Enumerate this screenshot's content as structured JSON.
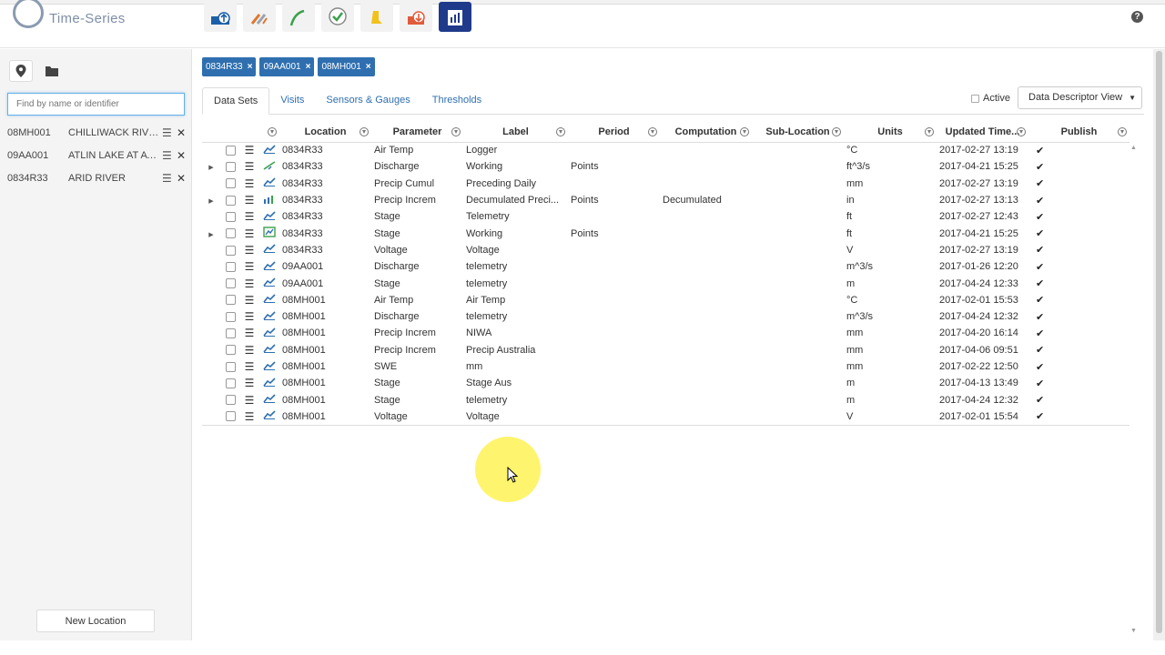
{
  "app": {
    "logo_text": "Time-Series"
  },
  "toolbar": {
    "buttons": [
      {
        "icon": "upload-icon"
      },
      {
        "icon": "tools-icon"
      },
      {
        "icon": "curve-icon"
      },
      {
        "icon": "approval-icon"
      },
      {
        "icon": "alert-icon"
      },
      {
        "icon": "download-icon"
      },
      {
        "icon": "report-icon"
      }
    ]
  },
  "sidebar": {
    "search_placeholder": "Find by name or identifier",
    "locations": [
      {
        "id": "08MH001",
        "name": "CHILLIWACK RIVE..."
      },
      {
        "id": "09AA001",
        "name": "ATLIN LAKE AT AT..."
      },
      {
        "id": "0834R33",
        "name": "ARID RIVER"
      }
    ],
    "new_location_label": "New Location"
  },
  "chips": [
    {
      "label": "0834R33"
    },
    {
      "label": "09AA001"
    },
    {
      "label": "08MH001"
    }
  ],
  "tabs": [
    "Data Sets",
    "Visits",
    "Sensors & Gauges",
    "Thresholds"
  ],
  "active_option_label": "Active",
  "view_select_value": "Data Descriptor View",
  "table": {
    "columns": [
      "Location",
      "Parameter",
      "Label",
      "Period",
      "Computation",
      "Sub-Location",
      "Units",
      "Updated Time...",
      "Publish"
    ],
    "rows": [
      {
        "location": "0834R33",
        "parameter": "Air Temp",
        "label": "Logger",
        "period": "",
        "computation": "",
        "sublocation": "",
        "units": "°C",
        "updated": "2017-02-27 13:19",
        "publish": "✔"
      },
      {
        "location": "0834R33",
        "parameter": "Discharge",
        "label": "Working",
        "period": "Points",
        "computation": "",
        "sublocation": "",
        "units": "ft^3/s",
        "updated": "2017-04-21 15:25",
        "publish": "✔"
      },
      {
        "location": "0834R33",
        "parameter": "Precip Cumul",
        "label": "Preceding Daily",
        "period": "",
        "computation": "",
        "sublocation": "",
        "units": "mm",
        "updated": "2017-02-27 13:19",
        "publish": "✔"
      },
      {
        "location": "0834R33",
        "parameter": "Precip Increm",
        "label": "Decumulated Preci...",
        "period": "Points",
        "computation": "Decumulated",
        "sublocation": "",
        "units": "in",
        "updated": "2017-02-27 13:13",
        "publish": "✔"
      },
      {
        "location": "0834R33",
        "parameter": "Stage",
        "label": "Telemetry",
        "period": "",
        "computation": "",
        "sublocation": "",
        "units": "ft",
        "updated": "2017-02-27 12:43",
        "publish": "✔"
      },
      {
        "location": "0834R33",
        "parameter": "Stage",
        "label": "Working",
        "period": "Points",
        "computation": "",
        "sublocation": "",
        "units": "ft",
        "updated": "2017-04-21 15:25",
        "publish": "✔"
      },
      {
        "location": "0834R33",
        "parameter": "Voltage",
        "label": "Voltage",
        "period": "",
        "computation": "",
        "sublocation": "",
        "units": "V",
        "updated": "2017-02-27 13:19",
        "publish": "✔"
      },
      {
        "location": "09AA001",
        "parameter": "Discharge",
        "label": "telemetry",
        "period": "",
        "computation": "",
        "sublocation": "",
        "units": "m^3/s",
        "updated": "2017-01-26 12:20",
        "publish": "✔"
      },
      {
        "location": "09AA001",
        "parameter": "Stage",
        "label": "telemetry",
        "period": "",
        "computation": "",
        "sublocation": "",
        "units": "m",
        "updated": "2017-04-24 12:33",
        "publish": "✔"
      },
      {
        "location": "08MH001",
        "parameter": "Air Temp",
        "label": "Air Temp",
        "period": "",
        "computation": "",
        "sublocation": "",
        "units": "°C",
        "updated": "2017-02-01 15:53",
        "publish": "✔"
      },
      {
        "location": "08MH001",
        "parameter": "Discharge",
        "label": "telemetry",
        "period": "",
        "computation": "",
        "sublocation": "",
        "units": "m^3/s",
        "updated": "2017-04-24 12:32",
        "publish": "✔"
      },
      {
        "location": "08MH001",
        "parameter": "Precip Increm",
        "label": "NIWA",
        "period": "",
        "computation": "",
        "sublocation": "",
        "units": "mm",
        "updated": "2017-04-20 16:14",
        "publish": "✔"
      },
      {
        "location": "08MH001",
        "parameter": "Precip Increm",
        "label": "Precip Australia",
        "period": "",
        "computation": "",
        "sublocation": "",
        "units": "mm",
        "updated": "2017-04-06 09:51",
        "publish": "✔"
      },
      {
        "location": "08MH001",
        "parameter": "SWE",
        "label": "mm",
        "period": "",
        "computation": "",
        "sublocation": "",
        "units": "mm",
        "updated": "2017-02-22 12:50",
        "publish": "✔"
      },
      {
        "location": "08MH001",
        "parameter": "Stage",
        "label": "Stage Aus",
        "period": "",
        "computation": "",
        "sublocation": "",
        "units": "m",
        "updated": "2017-04-13 13:49",
        "publish": "✔"
      },
      {
        "location": "08MH001",
        "parameter": "Stage",
        "label": "telemetry",
        "period": "",
        "computation": "",
        "sublocation": "",
        "units": "m",
        "updated": "2017-04-24 12:32",
        "publish": "✔"
      },
      {
        "location": "08MH001",
        "parameter": "Voltage",
        "label": "Voltage",
        "period": "",
        "computation": "",
        "sublocation": "",
        "units": "V",
        "updated": "2017-02-01 15:54",
        "publish": "✔"
      }
    ]
  },
  "row_meta": [
    {
      "expandable": false,
      "type_icon": "line-chart-icon"
    },
    {
      "expandable": true,
      "type_icon": "rating-curve-icon"
    },
    {
      "expandable": false,
      "type_icon": "line-chart-icon"
    },
    {
      "expandable": true,
      "type_icon": "bar-chart-icon"
    },
    {
      "expandable": false,
      "type_icon": "line-chart-icon"
    },
    {
      "expandable": true,
      "type_icon": "derived-series-icon"
    },
    {
      "expandable": false,
      "type_icon": "line-chart-icon"
    },
    {
      "expandable": false,
      "type_icon": "line-chart-icon"
    },
    {
      "expandable": false,
      "type_icon": "line-chart-icon"
    },
    {
      "expandable": false,
      "type_icon": "line-chart-icon"
    },
    {
      "expandable": false,
      "type_icon": "line-chart-icon"
    },
    {
      "expandable": false,
      "type_icon": "line-chart-icon"
    },
    {
      "expandable": false,
      "type_icon": "line-chart-icon"
    },
    {
      "expandable": false,
      "type_icon": "line-chart-icon"
    },
    {
      "expandable": false,
      "type_icon": "line-chart-icon"
    },
    {
      "expandable": false,
      "type_icon": "line-chart-icon"
    },
    {
      "expandable": false,
      "type_icon": "line-chart-icon"
    }
  ],
  "colors": {
    "accent": "#2f6fb0",
    "chip": "#2f6fb0",
    "active_toolbar": "#1f3a8a"
  }
}
